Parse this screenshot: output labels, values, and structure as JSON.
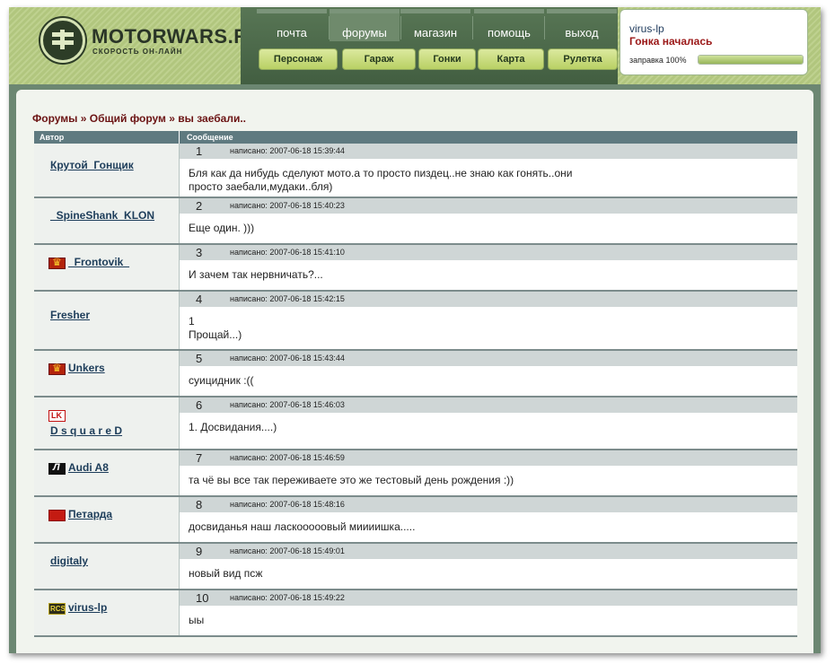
{
  "logo": {
    "title": "MOTORWARS.RU",
    "subtitle": "СКОРОСТЬ ОН-ЛАЙН"
  },
  "nav": {
    "top": [
      "почта",
      "форумы",
      "магазин",
      "помощь",
      "выход"
    ],
    "active_index": 1,
    "buttons": [
      "Персонаж",
      "Гараж",
      "Гонки",
      "Карта",
      "Рулетка"
    ]
  },
  "user": {
    "name": "virus-lp",
    "status": "Гонка началась",
    "fuel_label": "заправка 100%",
    "fuel_percent": 100
  },
  "breadcrumb": {
    "part1": "Форумы",
    "sep": " » ",
    "part2": "Общий форум",
    "part3": "вы заебали.."
  },
  "table": {
    "col_author": "Автор",
    "col_message": "Сообщение",
    "date_prefix": "написано: ",
    "posts": [
      {
        "num": "1",
        "author": "Крутой_Гонщик",
        "icon": "",
        "date": "2007-06-18 15:39:44",
        "text": "Бля как да нибудь сделуют мото.а то просто пиздец..не знаю как гонять..они\nпросто заебали,мудаки..бля)"
      },
      {
        "num": "2",
        "author": "_SpineShank_KLON",
        "icon": "",
        "date": "2007-06-18 15:40:23",
        "text": "Еще один. )))"
      },
      {
        "num": "3",
        "author": "_Frontovik_",
        "icon": "crown-clan-icon",
        "date": "2007-06-18 15:41:10",
        "text": "И зачем так нервничать?..."
      },
      {
        "num": "4",
        "author": "Fresher",
        "icon": "",
        "date": "2007-06-18 15:42:15",
        "text": "1\nПрощай...)"
      },
      {
        "num": "5",
        "author": "Unkers",
        "icon": "crown-clan-icon",
        "date": "2007-06-18 15:43:44",
        "text": "суицидник :(("
      },
      {
        "num": "6",
        "author": "D s q u a r e D",
        "icon": "lk-clan-icon",
        "date": "2007-06-18 15:46:03",
        "text": "1. Досвидания....)"
      },
      {
        "num": "7",
        "author": "Audi A8",
        "icon": "audi-clan-icon",
        "date": "2007-06-18 15:46:59",
        "text": "та чё вы все так переживаете это же тестовый день рождения :))"
      },
      {
        "num": "8",
        "author": "Петарда",
        "icon": "red-clan-icon",
        "date": "2007-06-18 15:48:16",
        "text": "досвиданья наш ласкооооовый миииишка....."
      },
      {
        "num": "9",
        "author": "digitaly",
        "icon": "",
        "date": "2007-06-18 15:49:01",
        "text": "новый вид псж"
      },
      {
        "num": "10",
        "author": "virus-lp",
        "icon": "rcs-clan-icon",
        "date": "2007-06-18 15:49:22",
        "text": "ыы"
      }
    ]
  }
}
